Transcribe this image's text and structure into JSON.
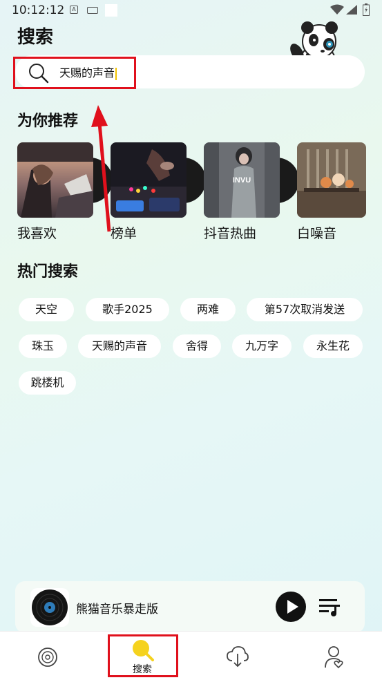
{
  "status_bar": {
    "time": "10:12:12"
  },
  "page": {
    "title": "搜索"
  },
  "search": {
    "value": "天赐的声音"
  },
  "sections": {
    "recommend_title": "为你推荐",
    "hot_title": "热门搜索"
  },
  "recommend": [
    {
      "label": "我喜欢"
    },
    {
      "label": "榜单"
    },
    {
      "label": "抖音热曲"
    },
    {
      "label": "白噪音"
    }
  ],
  "recommend_cover_text": {
    "invu": "INVU"
  },
  "hot_tags": [
    "天空",
    "歌手2025",
    "两难",
    "第57次取消发送",
    "珠玉",
    "天赐的声音",
    "舍得",
    "九万字",
    "永生花",
    "跳楼机"
  ],
  "player": {
    "title": "熊猫音乐暴走版"
  },
  "nav": {
    "search_label": "搜索"
  },
  "colors": {
    "annotation": "#e0101c",
    "accent": "#f5d21e"
  }
}
